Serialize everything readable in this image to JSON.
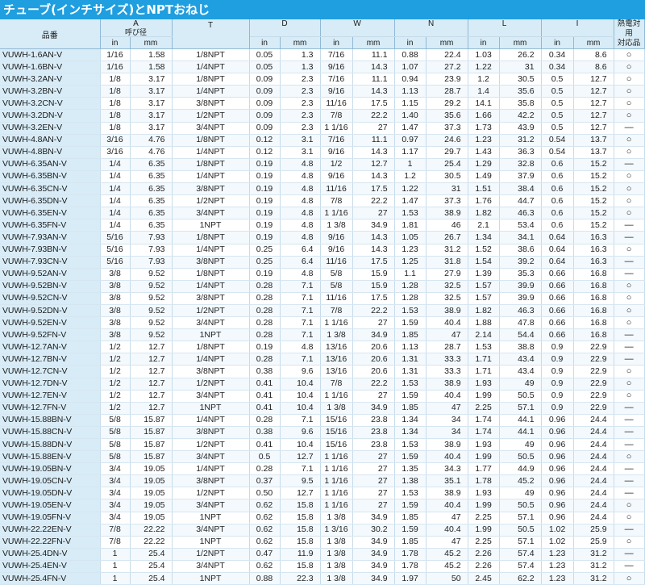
{
  "title": "チューブ(インチサイズ)とNPTおねじ",
  "headers": {
    "model": "品番",
    "A": "A",
    "A_sub": "呼び径",
    "T": "T",
    "D": "D",
    "W": "W",
    "N": "N",
    "L": "L",
    "I": "I",
    "mark": "熱電対用\n対応品",
    "in": "in",
    "mm": "mm"
  },
  "rows": [
    [
      "VUWH-1.6AN-V",
      "1/16",
      "1.58",
      "1/8NPT",
      "0.05",
      "1.3",
      "7/16",
      "11.1",
      "0.88",
      "22.4",
      "1.03",
      "26.2",
      "0.34",
      "8.6",
      "○"
    ],
    [
      "VUWH-1.6BN-V",
      "1/16",
      "1.58",
      "1/4NPT",
      "0.05",
      "1.3",
      "9/16",
      "14.3",
      "1.07",
      "27.2",
      "1.22",
      "31",
      "0.34",
      "8.6",
      "○"
    ],
    [
      "VUWH-3.2AN-V",
      "1/8",
      "3.17",
      "1/8NPT",
      "0.09",
      "2.3",
      "7/16",
      "11.1",
      "0.94",
      "23.9",
      "1.2",
      "30.5",
      "0.5",
      "12.7",
      "○"
    ],
    [
      "VUWH-3.2BN-V",
      "1/8",
      "3.17",
      "1/4NPT",
      "0.09",
      "2.3",
      "9/16",
      "14.3",
      "1.13",
      "28.7",
      "1.4",
      "35.6",
      "0.5",
      "12.7",
      "○"
    ],
    [
      "VUWH-3.2CN-V",
      "1/8",
      "3.17",
      "3/8NPT",
      "0.09",
      "2.3",
      "11/16",
      "17.5",
      "1.15",
      "29.2",
      "14.1",
      "35.8",
      "0.5",
      "12.7",
      "○"
    ],
    [
      "VUWH-3.2DN-V",
      "1/8",
      "3.17",
      "1/2NPT",
      "0.09",
      "2.3",
      "7/8",
      "22.2",
      "1.40",
      "35.6",
      "1.66",
      "42.2",
      "0.5",
      "12.7",
      "○"
    ],
    [
      "VUWH-3.2EN-V",
      "1/8",
      "3.17",
      "3/4NPT",
      "0.09",
      "2.3",
      "1 1/16",
      "27",
      "1.47",
      "37.3",
      "1.73",
      "43.9",
      "0.5",
      "12.7",
      "—"
    ],
    [
      "VUWH-4.8AN-V",
      "3/16",
      "4.76",
      "1/8NPT",
      "0.12",
      "3.1",
      "7/16",
      "11.1",
      "0.97",
      "24.6",
      "1.23",
      "31.2",
      "0.54",
      "13.7",
      "○"
    ],
    [
      "VUWH-4.8BN-V",
      "3/16",
      "4.76",
      "1/4NPT",
      "0.12",
      "3.1",
      "9/16",
      "14.3",
      "1.17",
      "29.7",
      "1.43",
      "36.3",
      "0.54",
      "13.7",
      "○"
    ],
    [
      "VUWH-6.35AN-V",
      "1/4",
      "6.35",
      "1/8NPT",
      "0.19",
      "4.8",
      "1/2",
      "12.7",
      "1",
      "25.4",
      "1.29",
      "32.8",
      "0.6",
      "15.2",
      "—"
    ],
    [
      "VUWH-6.35BN-V",
      "1/4",
      "6.35",
      "1/4NPT",
      "0.19",
      "4.8",
      "9/16",
      "14.3",
      "1.2",
      "30.5",
      "1.49",
      "37.9",
      "0.6",
      "15.2",
      "○"
    ],
    [
      "VUWH-6.35CN-V",
      "1/4",
      "6.35",
      "3/8NPT",
      "0.19",
      "4.8",
      "11/16",
      "17.5",
      "1.22",
      "31",
      "1.51",
      "38.4",
      "0.6",
      "15.2",
      "○"
    ],
    [
      "VUWH-6.35DN-V",
      "1/4",
      "6.35",
      "1/2NPT",
      "0.19",
      "4.8",
      "7/8",
      "22.2",
      "1.47",
      "37.3",
      "1.76",
      "44.7",
      "0.6",
      "15.2",
      "○"
    ],
    [
      "VUWH-6.35EN-V",
      "1/4",
      "6.35",
      "3/4NPT",
      "0.19",
      "4.8",
      "1 1/16",
      "27",
      "1.53",
      "38.9",
      "1.82",
      "46.3",
      "0.6",
      "15.2",
      "○"
    ],
    [
      "VUWH-6.35FN-V",
      "1/4",
      "6.35",
      "1NPT",
      "0.19",
      "4.8",
      "1 3/8",
      "34.9",
      "1.81",
      "46",
      "2.1",
      "53.4",
      "0.6",
      "15.2",
      "—"
    ],
    [
      "VUWH-7.93AN-V",
      "5/16",
      "7.93",
      "1/8NPT",
      "0.19",
      "4.8",
      "9/16",
      "14.3",
      "1.05",
      "26.7",
      "1.34",
      "34.1",
      "0.64",
      "16.3",
      "—"
    ],
    [
      "VUWH-7.93BN-V",
      "5/16",
      "7.93",
      "1/4NPT",
      "0.25",
      "6.4",
      "9/16",
      "14.3",
      "1.23",
      "31.2",
      "1.52",
      "38.6",
      "0.64",
      "16.3",
      "○"
    ],
    [
      "VUWH-7.93CN-V",
      "5/16",
      "7.93",
      "3/8NPT",
      "0.25",
      "6.4",
      "11/16",
      "17.5",
      "1.25",
      "31.8",
      "1.54",
      "39.2",
      "0.64",
      "16.3",
      "—"
    ],
    [
      "VUWH-9.52AN-V",
      "3/8",
      "9.52",
      "1/8NPT",
      "0.19",
      "4.8",
      "5/8",
      "15.9",
      "1.1",
      "27.9",
      "1.39",
      "35.3",
      "0.66",
      "16.8",
      "—"
    ],
    [
      "VUWH-9.52BN-V",
      "3/8",
      "9.52",
      "1/4NPT",
      "0.28",
      "7.1",
      "5/8",
      "15.9",
      "1.28",
      "32.5",
      "1.57",
      "39.9",
      "0.66",
      "16.8",
      "○"
    ],
    [
      "VUWH-9.52CN-V",
      "3/8",
      "9.52",
      "3/8NPT",
      "0.28",
      "7.1",
      "11/16",
      "17.5",
      "1.28",
      "32.5",
      "1.57",
      "39.9",
      "0.66",
      "16.8",
      "○"
    ],
    [
      "VUWH-9.52DN-V",
      "3/8",
      "9.52",
      "1/2NPT",
      "0.28",
      "7.1",
      "7/8",
      "22.2",
      "1.53",
      "38.9",
      "1.82",
      "46.3",
      "0.66",
      "16.8",
      "○"
    ],
    [
      "VUWH-9.52EN-V",
      "3/8",
      "9.52",
      "3/4NPT",
      "0.28",
      "7.1",
      "1 1/16",
      "27",
      "1.59",
      "40.4",
      "1.88",
      "47.8",
      "0.66",
      "16.8",
      "○"
    ],
    [
      "VUWH-9.52FN-V",
      "3/8",
      "9.52",
      "1NPT",
      "0.28",
      "7.1",
      "1 3/8",
      "34.9",
      "1.85",
      "47",
      "2.14",
      "54.4",
      "0.66",
      "16.8",
      "—"
    ],
    [
      "VUWH-12.7AN-V",
      "1/2",
      "12.7",
      "1/8NPT",
      "0.19",
      "4.8",
      "13/16",
      "20.6",
      "1.13",
      "28.7",
      "1.53",
      "38.8",
      "0.9",
      "22.9",
      "—"
    ],
    [
      "VUWH-12.7BN-V",
      "1/2",
      "12.7",
      "1/4NPT",
      "0.28",
      "7.1",
      "13/16",
      "20.6",
      "1.31",
      "33.3",
      "1.71",
      "43.4",
      "0.9",
      "22.9",
      "—"
    ],
    [
      "VUWH-12.7CN-V",
      "1/2",
      "12.7",
      "3/8NPT",
      "0.38",
      "9.6",
      "13/16",
      "20.6",
      "1.31",
      "33.3",
      "1.71",
      "43.4",
      "0.9",
      "22.9",
      "○"
    ],
    [
      "VUWH-12.7DN-V",
      "1/2",
      "12.7",
      "1/2NPT",
      "0.41",
      "10.4",
      "7/8",
      "22.2",
      "1.53",
      "38.9",
      "1.93",
      "49",
      "0.9",
      "22.9",
      "○"
    ],
    [
      "VUWH-12.7EN-V",
      "1/2",
      "12.7",
      "3/4NPT",
      "0.41",
      "10.4",
      "1 1/16",
      "27",
      "1.59",
      "40.4",
      "1.99",
      "50.5",
      "0.9",
      "22.9",
      "○"
    ],
    [
      "VUWH-12.7FN-V",
      "1/2",
      "12.7",
      "1NPT",
      "0.41",
      "10.4",
      "1 3/8",
      "34.9",
      "1.85",
      "47",
      "2.25",
      "57.1",
      "0.9",
      "22.9",
      "—"
    ],
    [
      "VUWH-15.88BN-V",
      "5/8",
      "15.87",
      "1/4NPT",
      "0.28",
      "7.1",
      "15/16",
      "23.8",
      "1.34",
      "34",
      "1.74",
      "44.1",
      "0.96",
      "24.4",
      "—"
    ],
    [
      "VUWH-15.88CN-V",
      "5/8",
      "15.87",
      "3/8NPT",
      "0.38",
      "9.6",
      "15/16",
      "23.8",
      "1.34",
      "34",
      "1.74",
      "44.1",
      "0.96",
      "24.4",
      "—"
    ],
    [
      "VUWH-15.88DN-V",
      "5/8",
      "15.87",
      "1/2NPT",
      "0.41",
      "10.4",
      "15/16",
      "23.8",
      "1.53",
      "38.9",
      "1.93",
      "49",
      "0.96",
      "24.4",
      "—"
    ],
    [
      "VUWH-15.88EN-V",
      "5/8",
      "15.87",
      "3/4NPT",
      "0.5",
      "12.7",
      "1 1/16",
      "27",
      "1.59",
      "40.4",
      "1.99",
      "50.5",
      "0.96",
      "24.4",
      "○"
    ],
    [
      "VUWH-19.05BN-V",
      "3/4",
      "19.05",
      "1/4NPT",
      "0.28",
      "7.1",
      "1 1/16",
      "27",
      "1.35",
      "34.3",
      "1.77",
      "44.9",
      "0.96",
      "24.4",
      "—"
    ],
    [
      "VUWH-19.05CN-V",
      "3/4",
      "19.05",
      "3/8NPT",
      "0.37",
      "9.5",
      "1 1/16",
      "27",
      "1.38",
      "35.1",
      "1.78",
      "45.2",
      "0.96",
      "24.4",
      "—"
    ],
    [
      "VUWH-19.05DN-V",
      "3/4",
      "19.05",
      "1/2NPT",
      "0.50",
      "12.7",
      "1 1/16",
      "27",
      "1.53",
      "38.9",
      "1.93",
      "49",
      "0.96",
      "24.4",
      "—"
    ],
    [
      "VUWH-19.05EN-V",
      "3/4",
      "19.05",
      "3/4NPT",
      "0.62",
      "15.8",
      "1 1/16",
      "27",
      "1.59",
      "40.4",
      "1.99",
      "50.5",
      "0.96",
      "24.4",
      "○"
    ],
    [
      "VUWH-19.05FN-V",
      "3/4",
      "19.05",
      "1NPT",
      "0.62",
      "15.8",
      "1 3/8",
      "34.9",
      "1.85",
      "47",
      "2.25",
      "57.1",
      "0.96",
      "24.4",
      "○"
    ],
    [
      "VUWH-22.22EN-V",
      "7/8",
      "22.22",
      "3/4NPT",
      "0.62",
      "15.8",
      "1 3/16",
      "30.2",
      "1.59",
      "40.4",
      "1.99",
      "50.5",
      "1.02",
      "25.9",
      "—"
    ],
    [
      "VUWH-22.22FN-V",
      "7/8",
      "22.22",
      "1NPT",
      "0.62",
      "15.8",
      "1 3/8",
      "34.9",
      "1.85",
      "47",
      "2.25",
      "57.1",
      "1.02",
      "25.9",
      "○"
    ],
    [
      "VUWH-25.4DN-V",
      "1",
      "25.4",
      "1/2NPT",
      "0.47",
      "11.9",
      "1 3/8",
      "34.9",
      "1.78",
      "45.2",
      "2.26",
      "57.4",
      "1.23",
      "31.2",
      "—"
    ],
    [
      "VUWH-25.4EN-V",
      "1",
      "25.4",
      "3/4NPT",
      "0.62",
      "15.8",
      "1 3/8",
      "34.9",
      "1.78",
      "45.2",
      "2.26",
      "57.4",
      "1.23",
      "31.2",
      "—"
    ],
    [
      "VUWH-25.4FN-V",
      "1",
      "25.4",
      "1NPT",
      "0.88",
      "22.3",
      "1 3/8",
      "34.9",
      "1.97",
      "50",
      "2.45",
      "62.2",
      "1.23",
      "31.2",
      "○"
    ]
  ]
}
